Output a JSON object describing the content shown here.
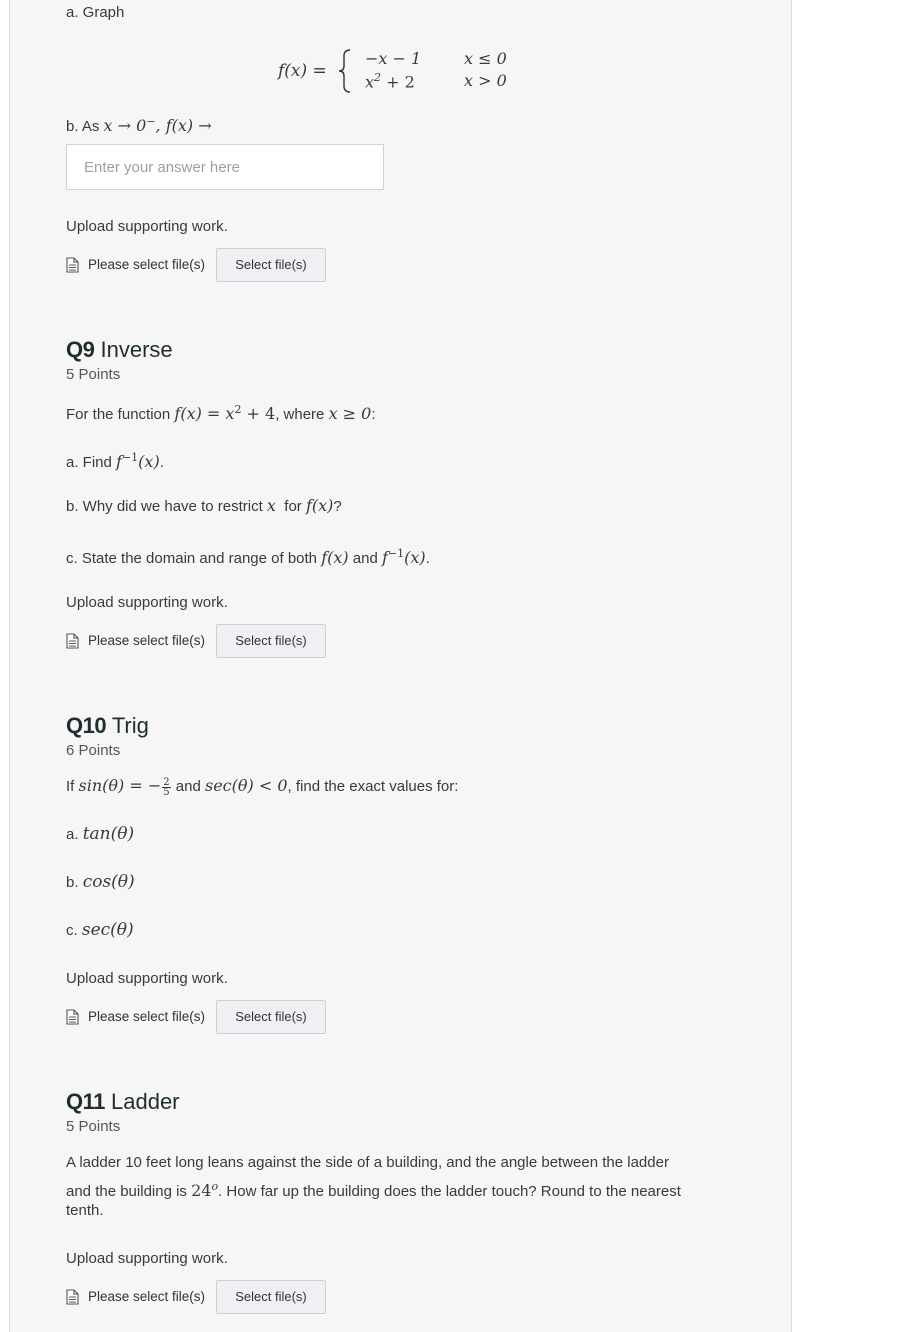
{
  "q8": {
    "part_a": "a. Graph",
    "piecewise": {
      "lhs": "f(x) =",
      "case1_expr": "−x − 1",
      "case1_cond": "x ≤ 0",
      "case2_expr_base": "x",
      "case2_expr_exp": "2",
      "case2_expr_rest": " + 2",
      "case2_cond": "x > 0"
    },
    "part_b_prefix": "b. As ",
    "part_b_math1": "x → 0",
    "part_b_sup": "−",
    "part_b_math2": ", f(x) →",
    "answer_placeholder": "Enter your answer here",
    "answer_value": "",
    "upload_label": "Upload supporting work.",
    "file_status": "Please select file(s)",
    "file_button": "Select file(s)"
  },
  "q9": {
    "number": "Q9",
    "name": "Inverse",
    "points": "5 Points",
    "intro": {
      "t1": "For the function ",
      "m1": "f(x) = x",
      "m1_sup": "2",
      "m2": " + 4",
      "t2": ", where ",
      "m3": "x ≥ 0",
      "t3": ":"
    },
    "part_a": {
      "t1": "a. Find ",
      "m1": "f",
      "sup": "−1",
      "m2": "(x)",
      "t2": "."
    },
    "part_b": {
      "t1": "b. Why did we have to restrict ",
      "m1": "x",
      "t2": "  for ",
      "m2": "f(x)",
      "t3": "?"
    },
    "part_c": {
      "t1": "c. State the domain and range of both ",
      "m1": "f(x)",
      "t2": " and ",
      "m2": "f",
      "sup": "−1",
      "m3": "(x)",
      "t3": "."
    },
    "upload_label": "Upload supporting work.",
    "file_status": "Please select file(s)",
    "file_button": "Select file(s)"
  },
  "q10": {
    "number": "Q10",
    "name": "Trig",
    "points": "6 Points",
    "intro": {
      "t1": "If ",
      "m1": "sin(θ) = −",
      "frac_num": "2",
      "frac_den": "5",
      "t2": " and ",
      "m2": "sec(θ) < 0",
      "t3": ", find the exact values for:"
    },
    "part_a": {
      "label": "a. ",
      "expr": "tan(θ)"
    },
    "part_b": {
      "label": "b. ",
      "expr": "cos(θ)"
    },
    "part_c": {
      "label": "c. ",
      "expr": "sec(θ)"
    },
    "upload_label": "Upload supporting work.",
    "file_status": "Please select file(s)",
    "file_button": "Select file(s)"
  },
  "q11": {
    "number": "Q11",
    "name": "Ladder",
    "points": "5 Points",
    "line1": "A ladder 10 feet long leans against the side of a building, and the angle between the ladder",
    "line2_a": "and the building is ",
    "line2_m": "24",
    "line2_sup": "o",
    "line2_b": ". How far up the building does the ladder touch? Round to the nearest",
    "line3": "tenth.",
    "upload_label": "Upload supporting work.",
    "file_status": "Please select file(s)",
    "file_button": "Select file(s)"
  }
}
